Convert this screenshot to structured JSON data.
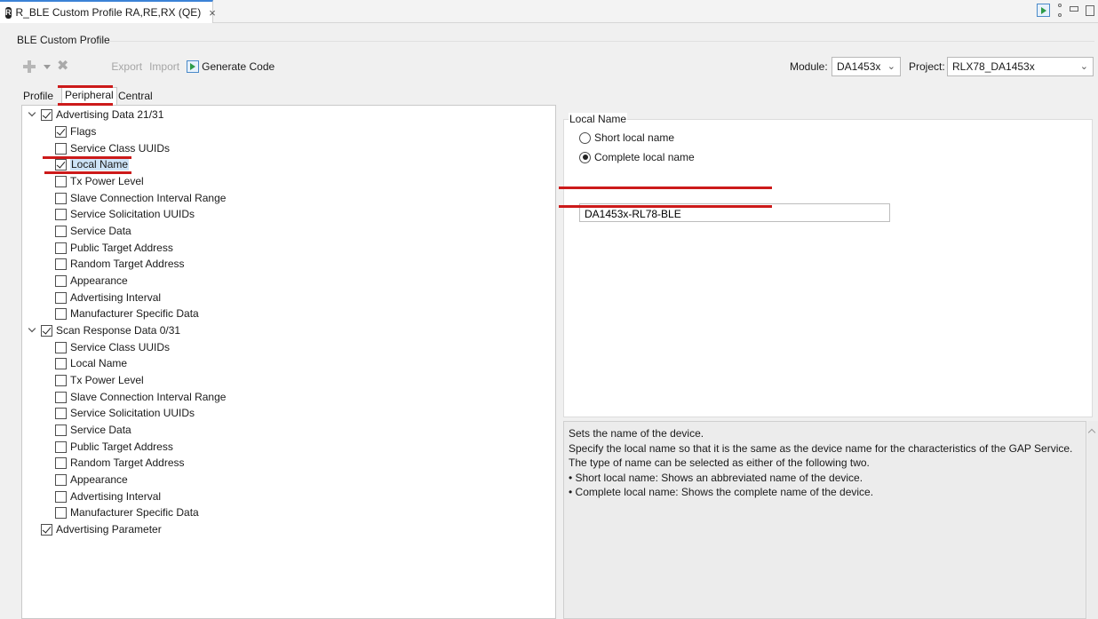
{
  "editor_tab": {
    "icon_text": "R",
    "title": "R_BLE Custom Profile RA,RE,RX (QE)",
    "close": "×"
  },
  "header": {
    "section_title": "BLE Custom Profile"
  },
  "toolbar": {
    "export_label": "Export",
    "import_label": "Import",
    "generate_label": "Generate Code",
    "module_label": "Module:",
    "module_value": "DA1453x",
    "project_label": "Project:",
    "project_value": "RLX78_DA1453x"
  },
  "tabs": [
    {
      "label": "Profile",
      "active": false
    },
    {
      "label": "Peripheral",
      "active": true
    },
    {
      "label": "Central",
      "active": false
    }
  ],
  "tree": {
    "advertising_data": {
      "label": "Advertising Data 21/31",
      "checked": true,
      "expanded": true,
      "items": [
        {
          "label": "Flags",
          "checked": true
        },
        {
          "label": "Service Class UUIDs",
          "checked": false
        },
        {
          "label": "Local Name",
          "checked": true,
          "selected": true
        },
        {
          "label": "Tx Power Level",
          "checked": false
        },
        {
          "label": "Slave Connection Interval Range",
          "checked": false
        },
        {
          "label": "Service Solicitation UUIDs",
          "checked": false
        },
        {
          "label": "Service Data",
          "checked": false
        },
        {
          "label": "Public Target Address",
          "checked": false
        },
        {
          "label": "Random Target Address",
          "checked": false
        },
        {
          "label": "Appearance",
          "checked": false
        },
        {
          "label": "Advertising Interval",
          "checked": false
        },
        {
          "label": "Manufacturer Specific Data",
          "checked": false
        }
      ]
    },
    "scan_response_data": {
      "label": "Scan Response Data 0/31",
      "checked": true,
      "expanded": true,
      "items": [
        {
          "label": "Service Class UUIDs",
          "checked": false
        },
        {
          "label": "Local Name",
          "checked": false
        },
        {
          "label": "Tx Power Level",
          "checked": false
        },
        {
          "label": "Slave Connection Interval Range",
          "checked": false
        },
        {
          "label": "Service Solicitation UUIDs",
          "checked": false
        },
        {
          "label": "Service Data",
          "checked": false
        },
        {
          "label": "Public Target Address",
          "checked": false
        },
        {
          "label": "Random Target Address",
          "checked": false
        },
        {
          "label": "Appearance",
          "checked": false
        },
        {
          "label": "Advertising Interval",
          "checked": false
        },
        {
          "label": "Manufacturer Specific Data",
          "checked": false
        }
      ]
    },
    "advertising_parameter": {
      "label": "Advertising Parameter",
      "checked": true
    }
  },
  "local_name": {
    "group_title": "Local Name",
    "options": [
      {
        "label": "Short local name",
        "selected": false
      },
      {
        "label": "Complete local name",
        "selected": true
      }
    ],
    "value": "DA1453x-RL78-BLE"
  },
  "description": {
    "lines": [
      "Sets the name of the device.",
      "Specify the local name so that it is the same as the device name for the characteristics of the GAP Service.",
      "The type of name can be selected as either of the following two.",
      "• Short local name: Shows an abbreviated name of the device.",
      "• Complete local name: Shows the complete name of the device."
    ]
  },
  "annotation_color": "#cc1a1a"
}
